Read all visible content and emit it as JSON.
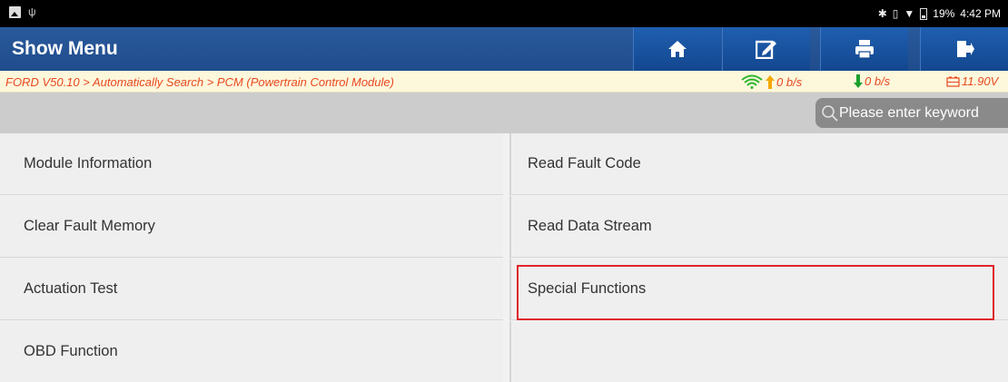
{
  "status_bar": {
    "battery_text": "19%",
    "time": "4:42 PM",
    "icons": [
      "image-icon",
      "usb-icon",
      "bluetooth-icon",
      "vibrate-icon",
      "wifi-icon",
      "battery-icon"
    ]
  },
  "header": {
    "title": "Show Menu",
    "buttons": [
      {
        "icon": "home-icon"
      },
      {
        "icon": "edit-report-icon"
      },
      {
        "icon": "print-icon"
      },
      {
        "icon": "exit-icon"
      }
    ],
    "colors": {
      "bar": "#1f4c8c",
      "button": "#1a55a3"
    }
  },
  "breadcrumb": {
    "path": "FORD V50.10 > Automatically Search > PCM (Powertrain Control Module)",
    "upload_rate": "0 b/s",
    "download_rate": "0 b/s",
    "voltage": "11.90V",
    "colors": {
      "text": "#e8491f",
      "upload_arrow": "#f5a800",
      "download_arrow": "#1aa12c",
      "wifi": "#2bb52b"
    }
  },
  "search": {
    "placeholder": "Please enter keyword"
  },
  "menu": {
    "items": [
      {
        "label": "Module Information"
      },
      {
        "label": "Read Fault Code"
      },
      {
        "label": "Clear Fault Memory"
      },
      {
        "label": "Read Data Stream"
      },
      {
        "label": "Actuation Test"
      },
      {
        "label": "Special Functions",
        "highlighted": true
      },
      {
        "label": "OBD Function"
      }
    ],
    "highlight_color": "#e0242c"
  }
}
